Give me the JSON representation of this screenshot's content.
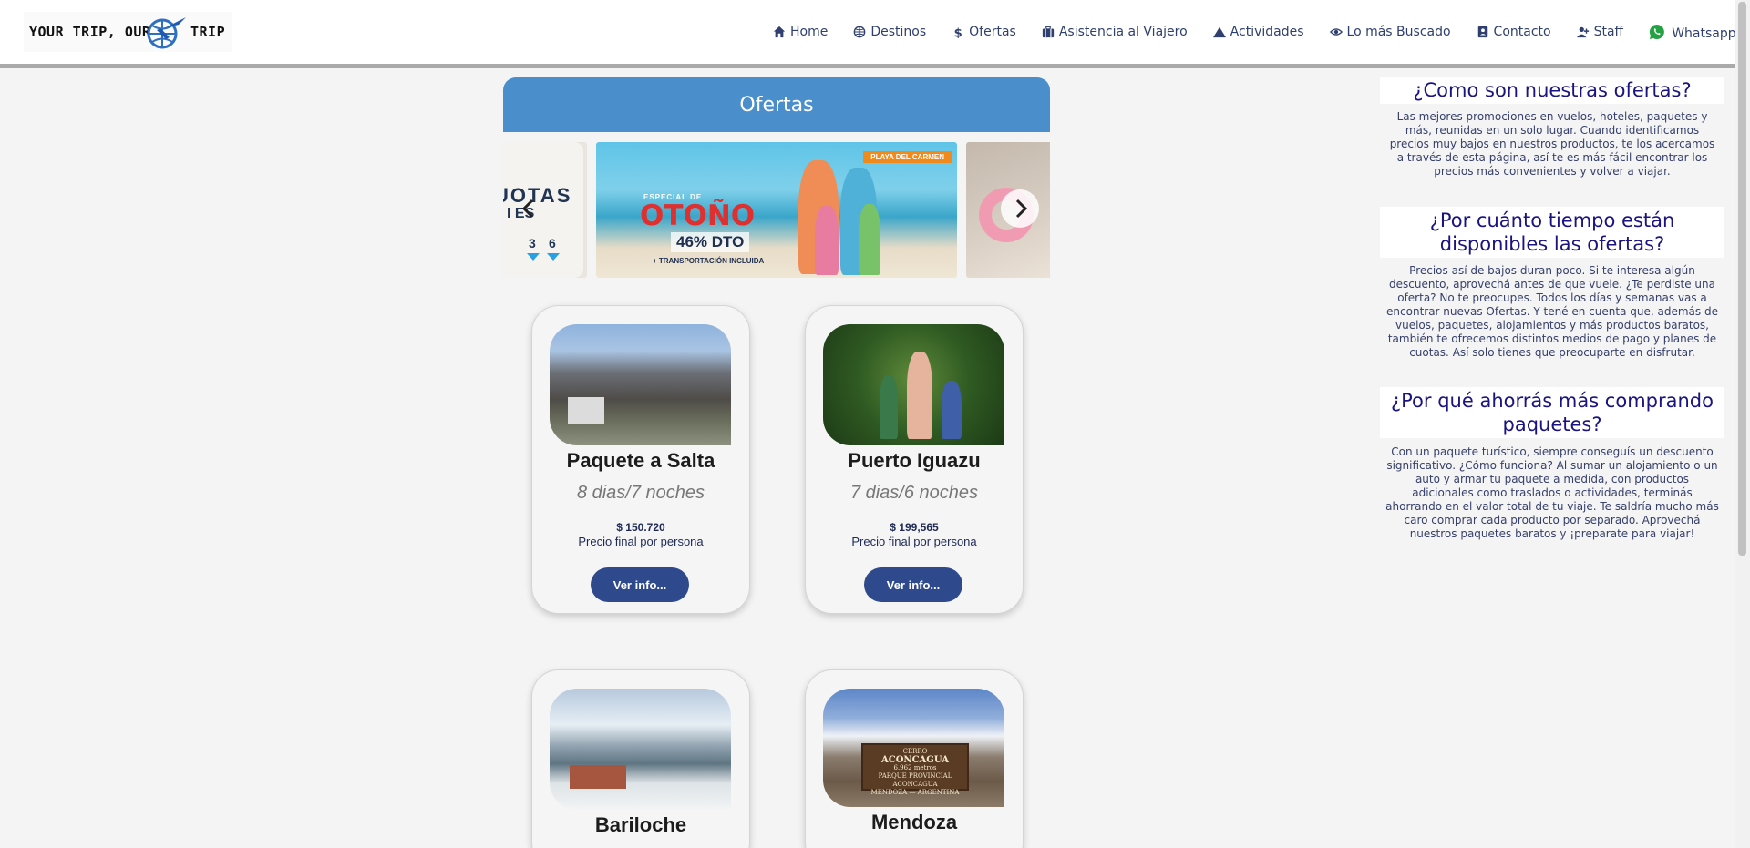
{
  "logo": {
    "left_text": "YOUR TRIP, OUR",
    "right_text": "TRIP"
  },
  "nav": [
    {
      "label": "Home",
      "icon": "home-icon"
    },
    {
      "label": "Destinos",
      "icon": "globe-icon"
    },
    {
      "label": "Ofertas",
      "icon": "dollar-icon"
    },
    {
      "label": "Asistencia al Viajero",
      "icon": "suitcase-icon"
    },
    {
      "label": "Actividades",
      "icon": "mountain-icon"
    },
    {
      "label": "Lo más Buscado",
      "icon": "eye-icon"
    },
    {
      "label": "Contacto",
      "icon": "contact-card-icon"
    },
    {
      "label": "Staff",
      "icon": "user-plus-icon"
    },
    {
      "label": "Whatsapp",
      "icon": "whatsapp-icon"
    }
  ],
  "offers": {
    "title": "Ofertas",
    "carousel": {
      "left_slide": {
        "big": "UOTAS",
        "small": "N I  ES",
        "n1": "3",
        "n2": "6"
      },
      "main_slide": {
        "tag": "PLAYA DEL CARMEN",
        "special": "ESPECIAL DE",
        "headline": "OTOÑO",
        "discount": "46% DTO",
        "extra": "+ TRANSPORTACIÓN INCLUIDA"
      }
    }
  },
  "cards": [
    {
      "title": "Paquete a Salta",
      "duration": "8 dias/7 noches",
      "price": "$ 150.720",
      "note": "Precio final por persona",
      "button": "Ver info..."
    },
    {
      "title": "Puerto Iguazu",
      "duration": "7 dias/6 noches",
      "price": "$ 199,565",
      "note": "Precio final por persona",
      "button": "Ver info..."
    },
    {
      "title": "Bariloche"
    },
    {
      "title": "Mendoza",
      "sign_line1": "CERRO",
      "sign_line2": "ACONCAGUA",
      "sign_line3": "6.962 metros",
      "sign_line4": "PARQUE PROVINCIAL ACONCAGUA",
      "sign_line5": "MENDOZA — ARGENTINA"
    }
  ],
  "sidebar": [
    {
      "title": "¿Como son nuestras ofertas?",
      "text": "Las mejores promociones en vuelos, hoteles, paquetes y más, reunidas en un solo lugar. Cuando identificamos precios muy bajos en nuestros productos, te los acercamos a través de esta página, así te es más fácil encontrar los precios más convenientes y volver a viajar."
    },
    {
      "title": "¿Por cuánto tiempo están disponibles las ofertas?",
      "text": "Precios así de bajos duran poco. Si te interesa algún descuento, aprovechá antes de que vuele. ¿Te perdiste una oferta? No te preocupes. Todos los días y semanas vas a encontrar nuevas Ofertas. Y tené en cuenta que, además de vuelos, paquetes, alojamientos y más productos baratos, también te ofrecemos distintos medios de pago y planes de cuotas. Así solo tienes que preocuparte en disfrutar."
    },
    {
      "title": "¿Por qué ahorrás más comprando paquetes?",
      "text": "Con un paquete turístico, siempre conseguís un descuento significativo. ¿Cómo funciona? Al sumar un alojamiento o un auto y armar tu paquete a medida, con productos adicionales como traslados o actividades, terminás ahorrando en el valor total de tu viaje. Te saldría mucho más caro comprar cada producto por separado. Aprovechá nuestros paquetes baratos y ¡preparate para viajar!"
    }
  ]
}
